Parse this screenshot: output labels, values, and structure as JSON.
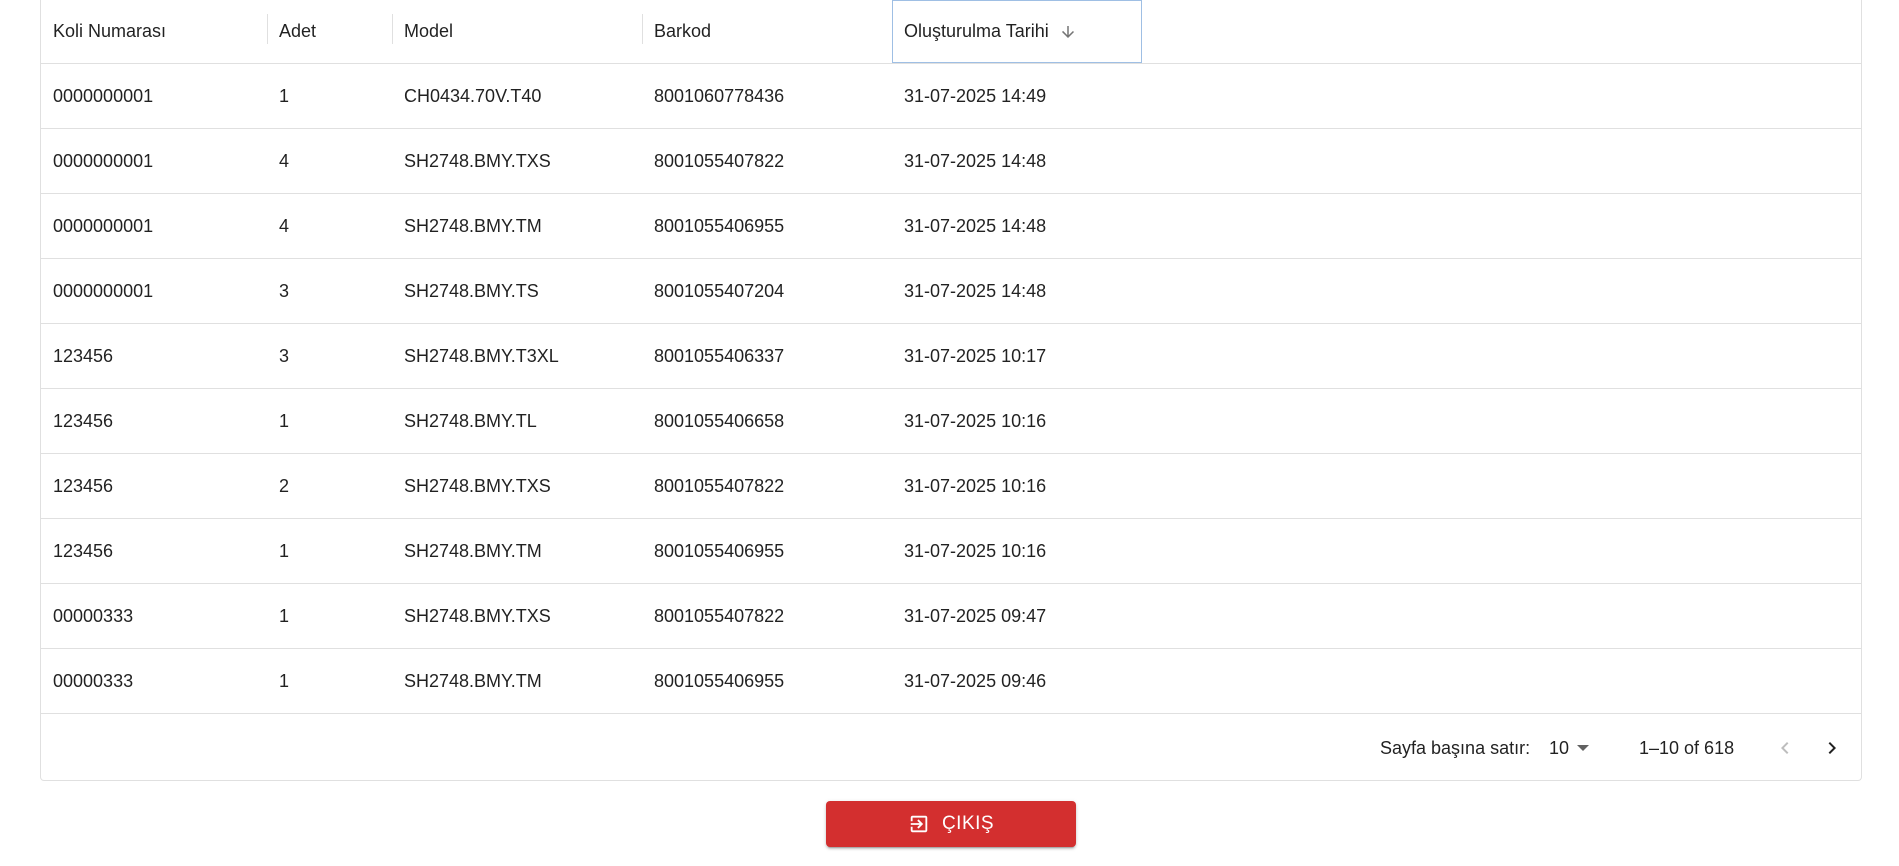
{
  "table": {
    "columns": [
      "Koli Numarası",
      "Adet",
      "Model",
      "Barkod",
      "Oluşturulma Tarihi"
    ],
    "sorted_column": "Oluşturulma Tarihi",
    "sort_direction": "descending",
    "sort_icon": "arrow-down-icon",
    "rows": [
      [
        "0000000001",
        "1",
        "CH0434.70V.T40",
        "8001060778436",
        "31-07-2025 14:49"
      ],
      [
        "0000000001",
        "4",
        "SH2748.BMY.TXS",
        "8001055407822",
        "31-07-2025 14:48"
      ],
      [
        "0000000001",
        "4",
        "SH2748.BMY.TM",
        "8001055406955",
        "31-07-2025 14:48"
      ],
      [
        "0000000001",
        "3",
        "SH2748.BMY.TS",
        "8001055407204",
        "31-07-2025 14:48"
      ],
      [
        "123456",
        "3",
        "SH2748.BMY.T3XL",
        "8001055406337",
        "31-07-2025 10:17"
      ],
      [
        "123456",
        "1",
        "SH2748.BMY.TL",
        "8001055406658",
        "31-07-2025 10:16"
      ],
      [
        "123456",
        "2",
        "SH2748.BMY.TXS",
        "8001055407822",
        "31-07-2025 10:16"
      ],
      [
        "123456",
        "1",
        "SH2748.BMY.TM",
        "8001055406955",
        "31-07-2025 10:16"
      ],
      [
        "00000333",
        "1",
        "SH2748.BMY.TXS",
        "8001055407822",
        "31-07-2025 09:47"
      ],
      [
        "00000333",
        "1",
        "SH2748.BMY.TM",
        "8001055406955",
        "31-07-2025 09:46"
      ]
    ]
  },
  "pagination": {
    "rows_per_page_label": "Sayfa başına satır:",
    "rows_per_page_value": "10",
    "range_text": "1–10 of 618",
    "prev_icon": "chevron-left-icon",
    "next_icon": "chevron-right-icon"
  },
  "exit_button": {
    "label": "ÇIKIŞ",
    "icon": "exit-icon",
    "color": "#d32f2f"
  }
}
